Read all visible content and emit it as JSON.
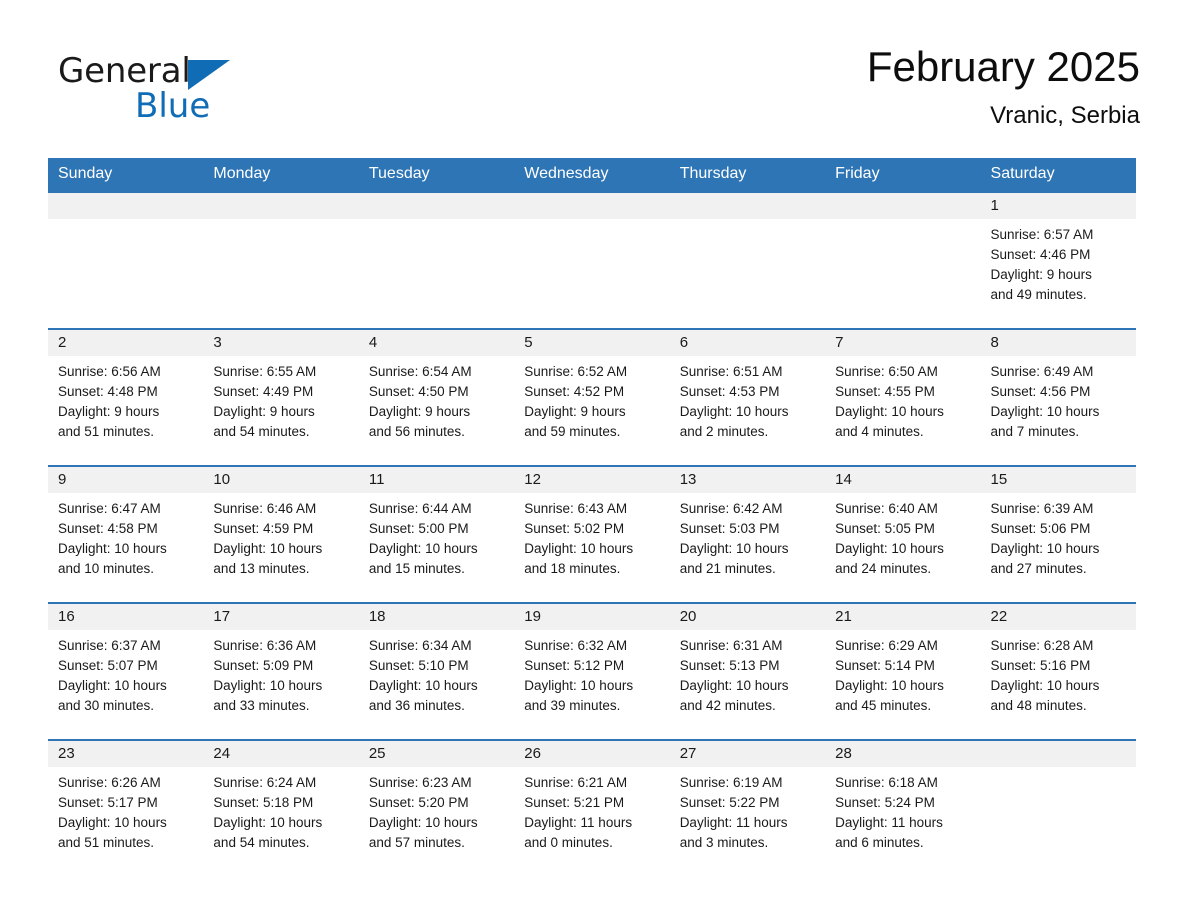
{
  "brand": {
    "word1": "General",
    "word2": "Blue",
    "triangle_color": "#0f6cb5",
    "blue_text_color": "#0f6cb5",
    "logo_icon": "triangle-logo-icon"
  },
  "header": {
    "title": "February 2025",
    "subtitle": "Vranic, Serbia"
  },
  "theme": {
    "header_blue": "#2e75b6",
    "row_divider_blue": "#2e75b6",
    "daynum_band": "#f1f1f1",
    "page_background": "#ffffff",
    "text": "#1a1a1a"
  },
  "weekday_headers": [
    "Sunday",
    "Monday",
    "Tuesday",
    "Wednesday",
    "Thursday",
    "Friday",
    "Saturday"
  ],
  "weeks": [
    [
      {
        "empty": true
      },
      {
        "empty": true
      },
      {
        "empty": true
      },
      {
        "empty": true
      },
      {
        "empty": true
      },
      {
        "empty": true
      },
      {
        "day": "1",
        "sunrise": "Sunrise: 6:57 AM",
        "sunset": "Sunset: 4:46 PM",
        "daylight1": "Daylight: 9 hours",
        "daylight2": "and 49 minutes."
      }
    ],
    [
      {
        "day": "2",
        "sunrise": "Sunrise: 6:56 AM",
        "sunset": "Sunset: 4:48 PM",
        "daylight1": "Daylight: 9 hours",
        "daylight2": "and 51 minutes."
      },
      {
        "day": "3",
        "sunrise": "Sunrise: 6:55 AM",
        "sunset": "Sunset: 4:49 PM",
        "daylight1": "Daylight: 9 hours",
        "daylight2": "and 54 minutes."
      },
      {
        "day": "4",
        "sunrise": "Sunrise: 6:54 AM",
        "sunset": "Sunset: 4:50 PM",
        "daylight1": "Daylight: 9 hours",
        "daylight2": "and 56 minutes."
      },
      {
        "day": "5",
        "sunrise": "Sunrise: 6:52 AM",
        "sunset": "Sunset: 4:52 PM",
        "daylight1": "Daylight: 9 hours",
        "daylight2": "and 59 minutes."
      },
      {
        "day": "6",
        "sunrise": "Sunrise: 6:51 AM",
        "sunset": "Sunset: 4:53 PM",
        "daylight1": "Daylight: 10 hours",
        "daylight2": "and 2 minutes."
      },
      {
        "day": "7",
        "sunrise": "Sunrise: 6:50 AM",
        "sunset": "Sunset: 4:55 PM",
        "daylight1": "Daylight: 10 hours",
        "daylight2": "and 4 minutes."
      },
      {
        "day": "8",
        "sunrise": "Sunrise: 6:49 AM",
        "sunset": "Sunset: 4:56 PM",
        "daylight1": "Daylight: 10 hours",
        "daylight2": "and 7 minutes."
      }
    ],
    [
      {
        "day": "9",
        "sunrise": "Sunrise: 6:47 AM",
        "sunset": "Sunset: 4:58 PM",
        "daylight1": "Daylight: 10 hours",
        "daylight2": "and 10 minutes."
      },
      {
        "day": "10",
        "sunrise": "Sunrise: 6:46 AM",
        "sunset": "Sunset: 4:59 PM",
        "daylight1": "Daylight: 10 hours",
        "daylight2": "and 13 minutes."
      },
      {
        "day": "11",
        "sunrise": "Sunrise: 6:44 AM",
        "sunset": "Sunset: 5:00 PM",
        "daylight1": "Daylight: 10 hours",
        "daylight2": "and 15 minutes."
      },
      {
        "day": "12",
        "sunrise": "Sunrise: 6:43 AM",
        "sunset": "Sunset: 5:02 PM",
        "daylight1": "Daylight: 10 hours",
        "daylight2": "and 18 minutes."
      },
      {
        "day": "13",
        "sunrise": "Sunrise: 6:42 AM",
        "sunset": "Sunset: 5:03 PM",
        "daylight1": "Daylight: 10 hours",
        "daylight2": "and 21 minutes."
      },
      {
        "day": "14",
        "sunrise": "Sunrise: 6:40 AM",
        "sunset": "Sunset: 5:05 PM",
        "daylight1": "Daylight: 10 hours",
        "daylight2": "and 24 minutes."
      },
      {
        "day": "15",
        "sunrise": "Sunrise: 6:39 AM",
        "sunset": "Sunset: 5:06 PM",
        "daylight1": "Daylight: 10 hours",
        "daylight2": "and 27 minutes."
      }
    ],
    [
      {
        "day": "16",
        "sunrise": "Sunrise: 6:37 AM",
        "sunset": "Sunset: 5:07 PM",
        "daylight1": "Daylight: 10 hours",
        "daylight2": "and 30 minutes."
      },
      {
        "day": "17",
        "sunrise": "Sunrise: 6:36 AM",
        "sunset": "Sunset: 5:09 PM",
        "daylight1": "Daylight: 10 hours",
        "daylight2": "and 33 minutes."
      },
      {
        "day": "18",
        "sunrise": "Sunrise: 6:34 AM",
        "sunset": "Sunset: 5:10 PM",
        "daylight1": "Daylight: 10 hours",
        "daylight2": "and 36 minutes."
      },
      {
        "day": "19",
        "sunrise": "Sunrise: 6:32 AM",
        "sunset": "Sunset: 5:12 PM",
        "daylight1": "Daylight: 10 hours",
        "daylight2": "and 39 minutes."
      },
      {
        "day": "20",
        "sunrise": "Sunrise: 6:31 AM",
        "sunset": "Sunset: 5:13 PM",
        "daylight1": "Daylight: 10 hours",
        "daylight2": "and 42 minutes."
      },
      {
        "day": "21",
        "sunrise": "Sunrise: 6:29 AM",
        "sunset": "Sunset: 5:14 PM",
        "daylight1": "Daylight: 10 hours",
        "daylight2": "and 45 minutes."
      },
      {
        "day": "22",
        "sunrise": "Sunrise: 6:28 AM",
        "sunset": "Sunset: 5:16 PM",
        "daylight1": "Daylight: 10 hours",
        "daylight2": "and 48 minutes."
      }
    ],
    [
      {
        "day": "23",
        "sunrise": "Sunrise: 6:26 AM",
        "sunset": "Sunset: 5:17 PM",
        "daylight1": "Daylight: 10 hours",
        "daylight2": "and 51 minutes."
      },
      {
        "day": "24",
        "sunrise": "Sunrise: 6:24 AM",
        "sunset": "Sunset: 5:18 PM",
        "daylight1": "Daylight: 10 hours",
        "daylight2": "and 54 minutes."
      },
      {
        "day": "25",
        "sunrise": "Sunrise: 6:23 AM",
        "sunset": "Sunset: 5:20 PM",
        "daylight1": "Daylight: 10 hours",
        "daylight2": "and 57 minutes."
      },
      {
        "day": "26",
        "sunrise": "Sunrise: 6:21 AM",
        "sunset": "Sunset: 5:21 PM",
        "daylight1": "Daylight: 11 hours",
        "daylight2": "and 0 minutes."
      },
      {
        "day": "27",
        "sunrise": "Sunrise: 6:19 AM",
        "sunset": "Sunset: 5:22 PM",
        "daylight1": "Daylight: 11 hours",
        "daylight2": "and 3 minutes."
      },
      {
        "day": "28",
        "sunrise": "Sunrise: 6:18 AM",
        "sunset": "Sunset: 5:24 PM",
        "daylight1": "Daylight: 11 hours",
        "daylight2": "and 6 minutes."
      },
      {
        "empty": true
      }
    ]
  ]
}
